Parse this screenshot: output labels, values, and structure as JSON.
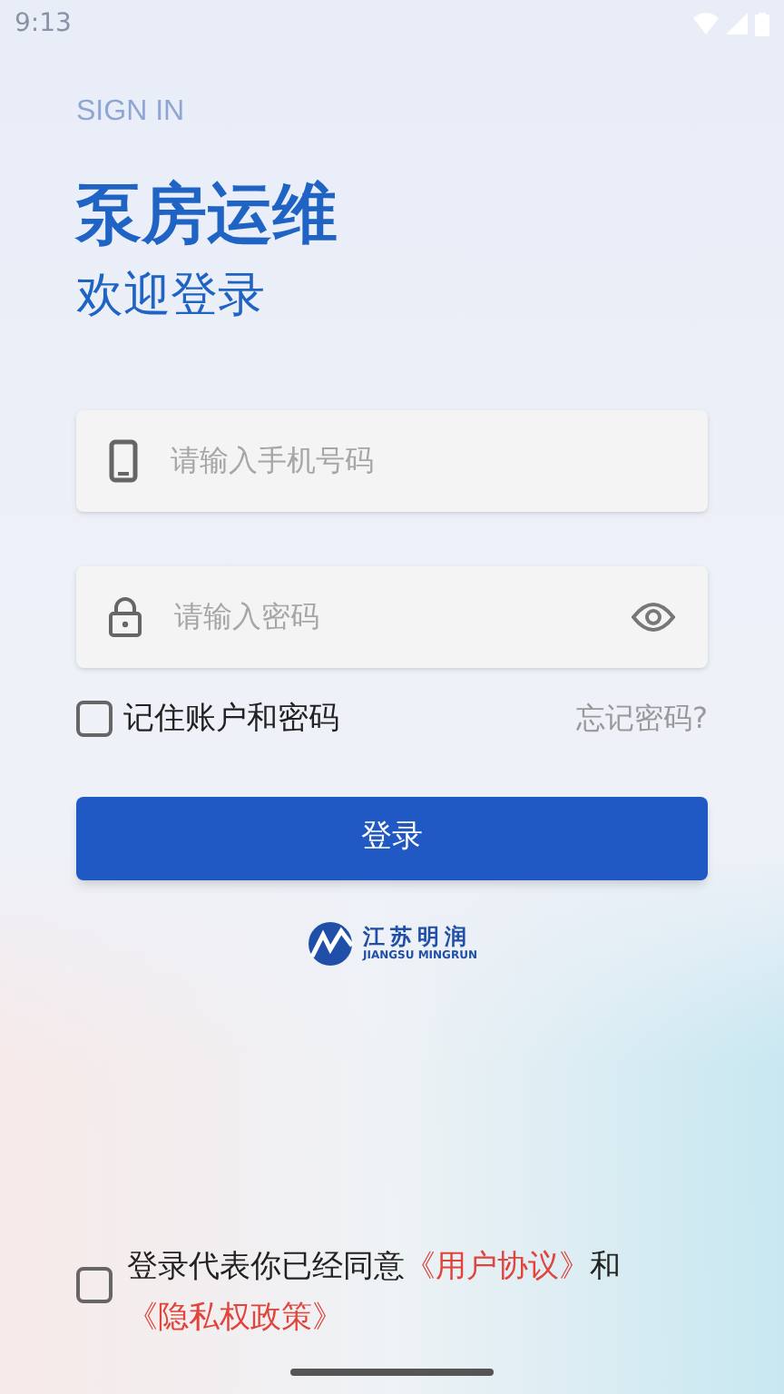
{
  "status_bar": {
    "time": "9:13"
  },
  "header": {
    "overline": "SIGN IN",
    "title": "泵房运维",
    "subtitle": "欢迎登录"
  },
  "phone_field": {
    "placeholder": "请输入手机号码"
  },
  "password_field": {
    "placeholder": "请输入密码"
  },
  "remember": {
    "label": "记住账户和密码",
    "checked": false
  },
  "forgot_link": "忘记密码?",
  "login_button": "登录",
  "logo": {
    "name": "江苏明润",
    "subtitle": "JIANGSU MINGRUN"
  },
  "agreement": {
    "checked": false,
    "parts": [
      {
        "kind": "text",
        "text": "登录代表你已经同意"
      },
      {
        "kind": "link",
        "text": "《用户协议》"
      },
      {
        "kind": "text",
        "text": "和"
      },
      {
        "kind": "link",
        "text": "《隐私权政策》"
      }
    ]
  }
}
